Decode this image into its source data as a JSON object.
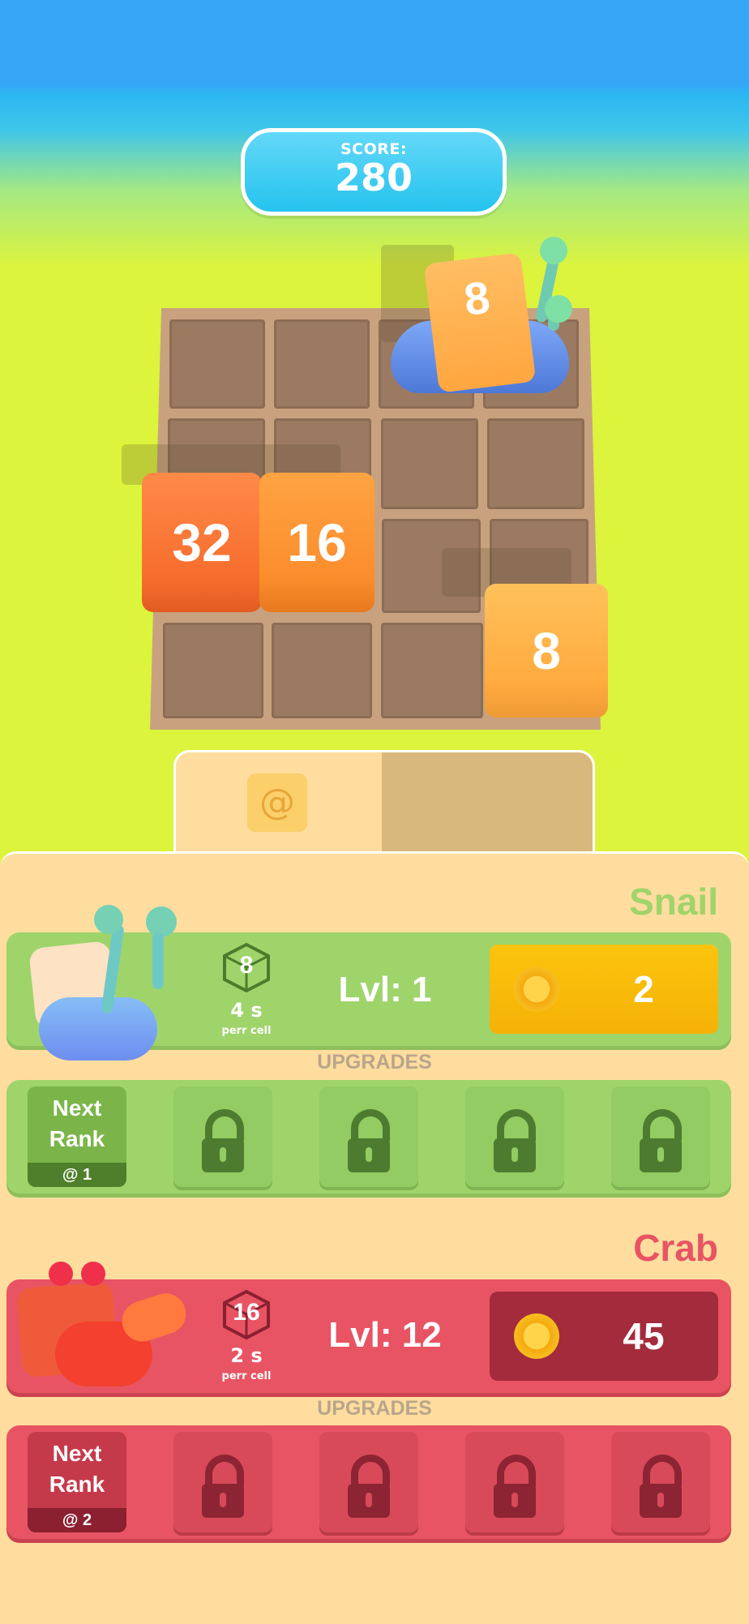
{
  "score": {
    "label": "SCORE:",
    "value": "280"
  },
  "board": {
    "tiles": [
      "32",
      "16",
      "8"
    ],
    "snail_tile": "8"
  },
  "panel": {
    "tab_icon": "snail-icon"
  },
  "creatures": [
    {
      "name": "Snail",
      "cube_value": "8",
      "rate": "4 s",
      "rate_sub": "perr cell",
      "level": "Lvl: 1",
      "price": "2",
      "upgrades_label": "UPGRADES",
      "next_rank_line1": "Next",
      "next_rank_line2": "Rank",
      "next_rank_count": "1",
      "color": "#9fd46b",
      "buy_color": "#fbbb0c"
    },
    {
      "name": "Crab",
      "cube_value": "16",
      "rate": "2 s",
      "rate_sub": "perr cell",
      "level": "Lvl: 12",
      "price": "45",
      "upgrades_label": "UPGRADES",
      "next_rank_line1": "Next",
      "next_rank_line2": "Rank",
      "next_rank_count": "2",
      "color": "#e85463",
      "buy_color": "#a22a3b"
    }
  ]
}
